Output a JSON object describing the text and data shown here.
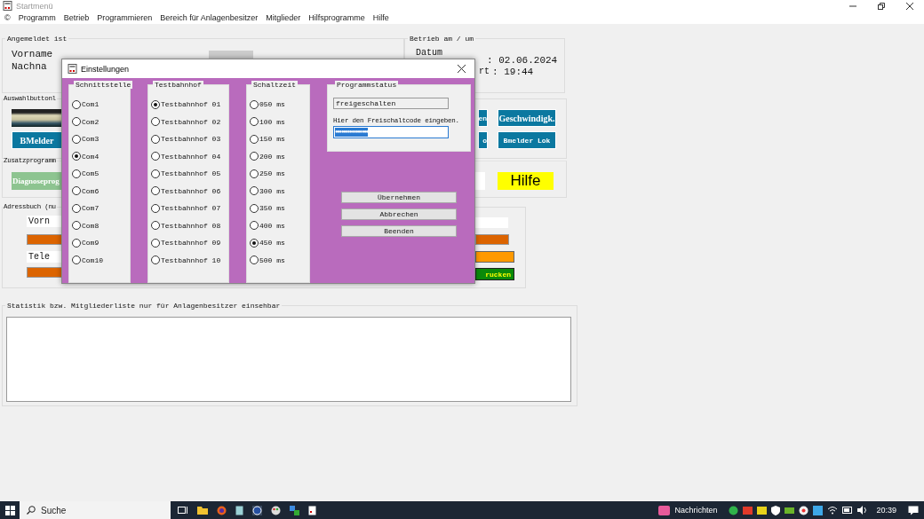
{
  "window": {
    "title": "Startmenü"
  },
  "menu": [
    "©",
    "Programm",
    "Betrieb",
    "Programmieren",
    "Bereich für Anlagenbesitzer",
    "Mitglieder",
    "Hilfsprogramme",
    "Hilfe"
  ],
  "login_group": {
    "title": "Angemeldet ist",
    "labels": [
      "Vorname",
      "Nachna"
    ]
  },
  "operation_group": {
    "title": "Betrieb am / um",
    "date_label": "Datum",
    "date_value": ": 02.06.2024",
    "time_label": "rt",
    "time_value": ": 19:44"
  },
  "selection_group": {
    "title": "Auswahlbuttonl",
    "left_button": "BMelder",
    "right_buttons": [
      {
        "label": "en",
        "kind": "partial"
      },
      {
        "label": "Geschwindigk.",
        "kind": "serif"
      },
      {
        "label": "o",
        "kind": "partial"
      },
      {
        "label": "Bmelder Lok",
        "kind": "mono"
      }
    ]
  },
  "extras_group": {
    "title": "Zusatzprogramm",
    "left_button": "Diagnoseprog",
    "help_button": "Hilfe"
  },
  "addressbook_group": {
    "title": "Adressbuch (nu",
    "fields": [
      "Vorn",
      "Tele"
    ],
    "print_button": "rucken"
  },
  "statistics_group": {
    "title": "Statistik bzw. Mitgliederliste nur für Anlagenbesitzer einsehbar"
  },
  "dialog": {
    "title": "Einstellungen",
    "groups": [
      {
        "title": "Schnittstelle",
        "options": [
          {
            "label": "Com1",
            "selected": false
          },
          {
            "label": "Com2",
            "selected": false
          },
          {
            "label": "Com3",
            "selected": false
          },
          {
            "label": "Com4",
            "selected": true
          },
          {
            "label": "Com5",
            "selected": false
          },
          {
            "label": "Com6",
            "selected": false
          },
          {
            "label": "Com7",
            "selected": false
          },
          {
            "label": "Com8",
            "selected": false
          },
          {
            "label": "Com9",
            "selected": false
          },
          {
            "label": "Com10",
            "selected": false
          }
        ]
      },
      {
        "title": "Testbahnhof",
        "options": [
          {
            "label": "Testbahnhof 01",
            "selected": true
          },
          {
            "label": "Testbahnhof 02",
            "selected": false
          },
          {
            "label": "Testbahnhof 03",
            "selected": false
          },
          {
            "label": "Testbahnhof 04",
            "selected": false
          },
          {
            "label": "Testbahnhof 05",
            "selected": false
          },
          {
            "label": "Testbahnhof 06",
            "selected": false
          },
          {
            "label": "Testbahnhof 07",
            "selected": false
          },
          {
            "label": "Testbahnhof 08",
            "selected": false
          },
          {
            "label": "Testbahnhof 09",
            "selected": false
          },
          {
            "label": "Testbahnhof 10",
            "selected": false
          }
        ]
      },
      {
        "title": "Schaltzeit",
        "options": [
          {
            "label": "050 ms",
            "selected": false
          },
          {
            "label": "100 ms",
            "selected": false
          },
          {
            "label": "150 ms",
            "selected": false
          },
          {
            "label": "200 ms",
            "selected": false
          },
          {
            "label": "250 ms",
            "selected": false
          },
          {
            "label": "300 ms",
            "selected": false
          },
          {
            "label": "350 ms",
            "selected": false
          },
          {
            "label": "400 ms",
            "selected": false
          },
          {
            "label": "450 ms",
            "selected": true
          },
          {
            "label": "500 ms",
            "selected": false
          }
        ]
      }
    ],
    "status": {
      "title": "Programmstatus",
      "value": "freigeschalten",
      "hint": "Hier den Freischaltcode eingeben.",
      "code": "●●●●●●●●●●●●●●●●"
    },
    "buttons": [
      "Übernehmen",
      "Abbrechen",
      "Beenden"
    ]
  },
  "taskbar": {
    "search_placeholder": "Suche",
    "news": "Nachrichten",
    "time": "20:39"
  }
}
